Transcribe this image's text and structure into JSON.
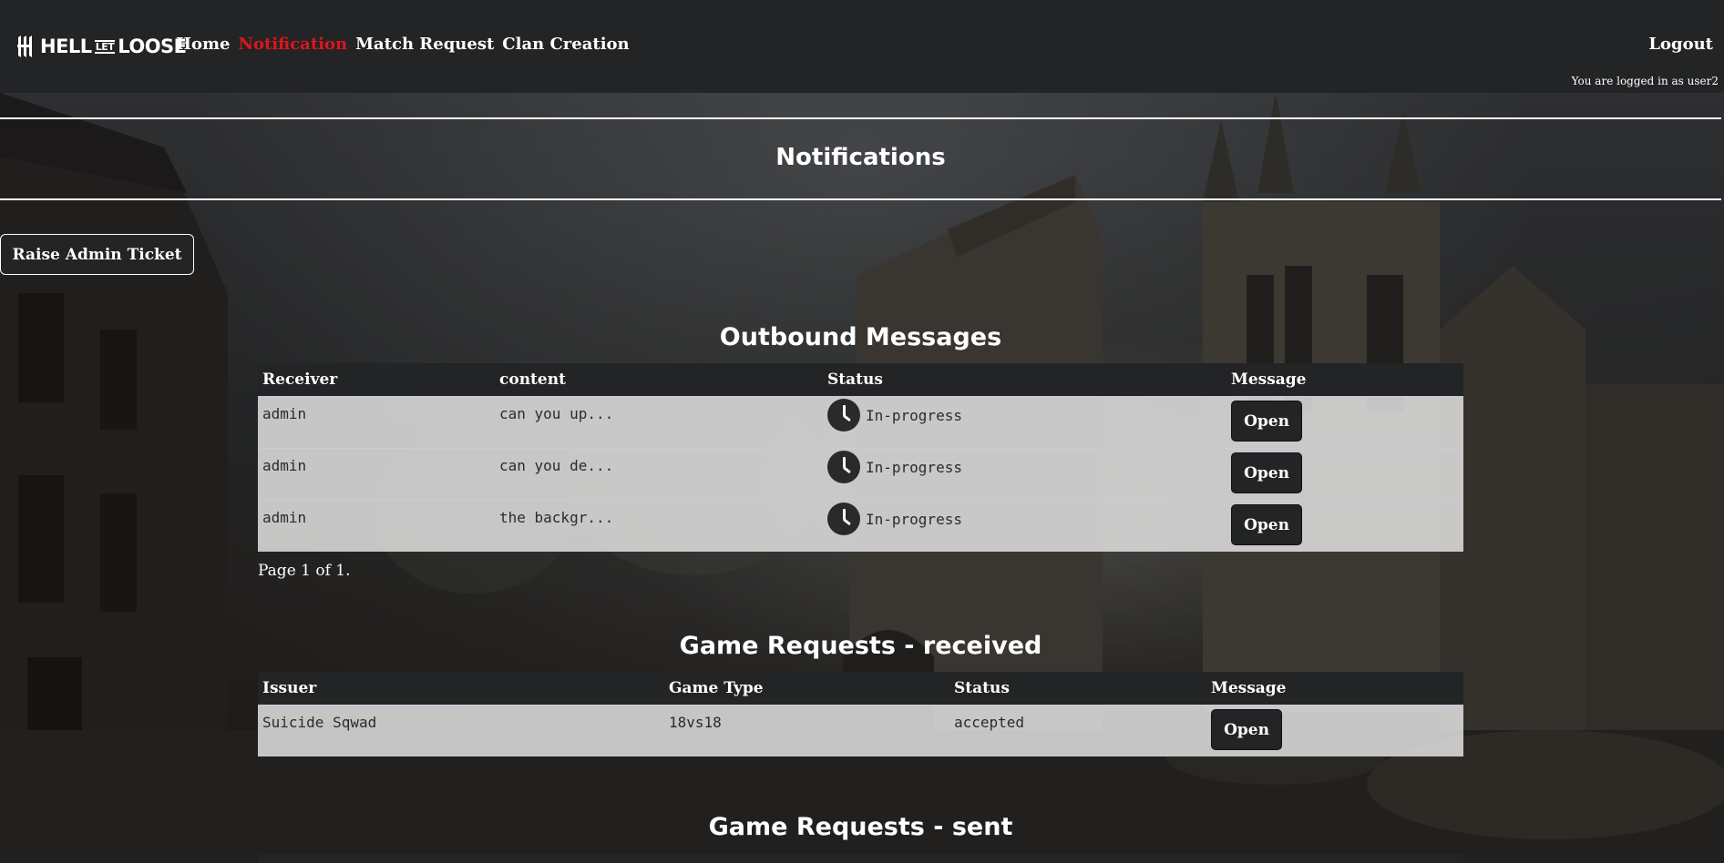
{
  "brand": {
    "logo_icon": "hll-logo-mark",
    "logo_text_1": "HELL",
    "logo_text_2": "LET",
    "logo_text_3": "LOOSE"
  },
  "nav": {
    "home": "Home",
    "notification": "Notification",
    "match_request": "Match Request",
    "clan_creation": "Clan Creation",
    "logout": "Logout",
    "logged_in_text": "You are logged in as user2",
    "active_color": "#e0141b"
  },
  "page": {
    "title": "Notifications",
    "raise_ticket": "Raise Admin Ticket"
  },
  "outbound": {
    "title": "Outbound Messages",
    "headers": [
      "Receiver",
      "content",
      "Status",
      "Message"
    ],
    "rows": [
      {
        "receiver": "admin",
        "content": "can you up...",
        "status": "In-progress",
        "status_icon": "clock-icon",
        "action": "Open"
      },
      {
        "receiver": "admin",
        "content": "can you de...",
        "status": "In-progress",
        "status_icon": "clock-icon",
        "action": "Open"
      },
      {
        "receiver": "admin",
        "content": "the backgr...",
        "status": "In-progress",
        "status_icon": "clock-icon",
        "action": "Open"
      }
    ],
    "pager": "Page 1 of 1."
  },
  "received": {
    "title": "Game Requests - received",
    "headers": [
      "Issuer",
      "Game Type",
      "Status",
      "Message"
    ],
    "rows": [
      {
        "issuer": "Suicide Sqwad",
        "game_type": "18vs18",
        "status": "accepted",
        "action": "Open"
      }
    ]
  },
  "sent": {
    "title": "Game Requests - sent"
  }
}
